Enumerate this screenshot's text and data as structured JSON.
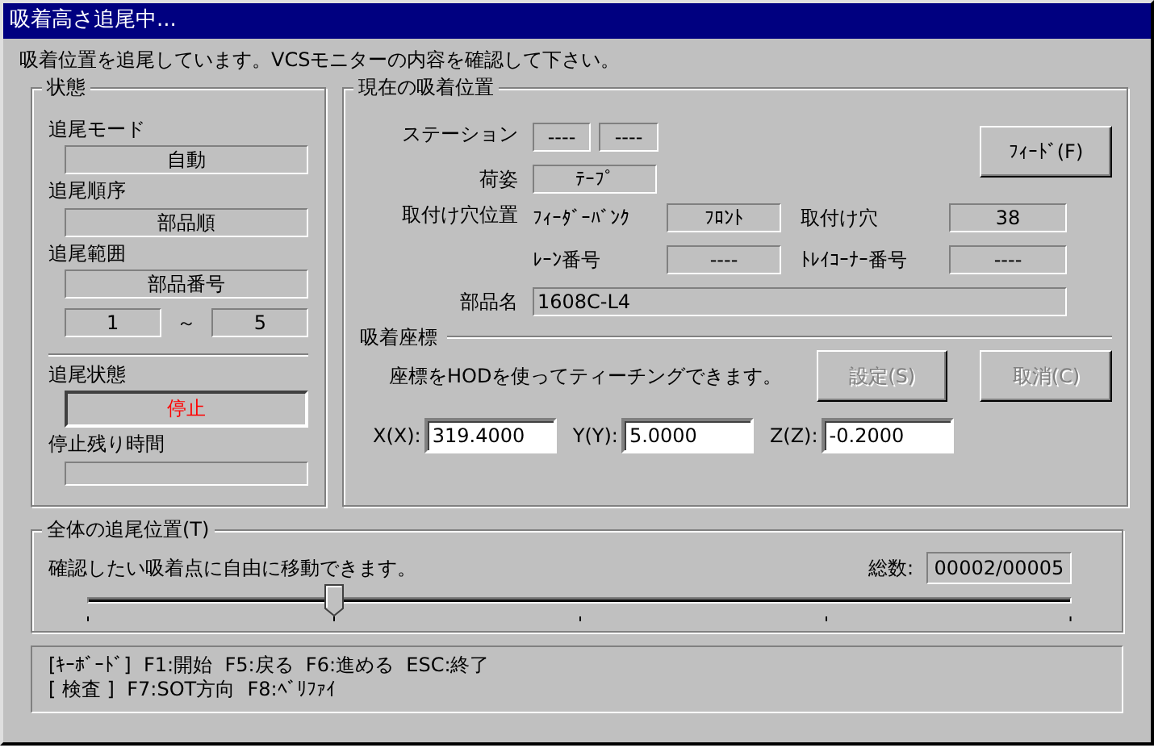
{
  "window": {
    "title": "吸着高さ追尾中..."
  },
  "message": "吸着位置を追尾しています。VCSモニターの内容を確認して下さい。",
  "status_group": {
    "title": "状態",
    "fields": [
      {
        "label": "追尾モード",
        "value": "自動"
      },
      {
        "label": "追尾順序",
        "value": "部品順"
      },
      {
        "label": "追尾範囲",
        "value": "部品番号"
      }
    ],
    "range": {
      "from": "1",
      "separator": "～",
      "to": "5"
    },
    "tracking_status": {
      "label": "追尾状態",
      "value": "停止",
      "stopped": true
    },
    "remaining_time": {
      "label": "停止残り時間"
    }
  },
  "position_group": {
    "title": "現在の吸着位置",
    "station": {
      "label": "ステーション",
      "values": [
        "----",
        "----"
      ]
    },
    "feed_button": {
      "label": "ﾌｨｰﾄﾞ(F)"
    },
    "package": {
      "label": "荷姿",
      "value": "ﾃｰﾌﾟ"
    },
    "hole_position": {
      "label": "取付け穴位置",
      "items": [
        {
          "label": "ﾌｨｰﾀﾞｰﾊﾞﾝｸ",
          "value": "ﾌﾛﾝﾄ"
        },
        {
          "label": "取付け穴",
          "value": "38"
        },
        {
          "label": "ﾚｰﾝ番号",
          "value": "----"
        },
        {
          "label": "ﾄﾚｲｺｰﾅｰ番号",
          "value": "----"
        }
      ]
    },
    "part_name": {
      "label": "部品名",
      "value": "1608C-L4"
    },
    "coordinates": {
      "title": "吸着座標",
      "hint": "座標をHODを使ってティーチングできます。",
      "buttons": [
        {
          "label": "設定(S)",
          "disabled": true
        },
        {
          "label": "取消(C)",
          "disabled": true
        }
      ],
      "axes": [
        {
          "label": "X(X):",
          "value": "319.4000"
        },
        {
          "label": "Y(Y):",
          "value": "5.0000"
        },
        {
          "label": "Z(Z):",
          "value": "-0.2000"
        }
      ]
    }
  },
  "overall_group": {
    "title": "全体の追尾位置(T)",
    "hint": "確認したい吸着点に自由に移動できます。",
    "total_label": "総数:",
    "total_value": "00002/00005",
    "slider": {
      "level": 0.25
    }
  },
  "help_lines": [
    "[ｷｰﾎﾞｰﾄﾞ]  F1:開始  F5:戻る  F6:進める  ESC:終了",
    "[ 検査 ]  F7:SOT方向  F8:ﾍﾞﾘﾌｧｲ"
  ]
}
